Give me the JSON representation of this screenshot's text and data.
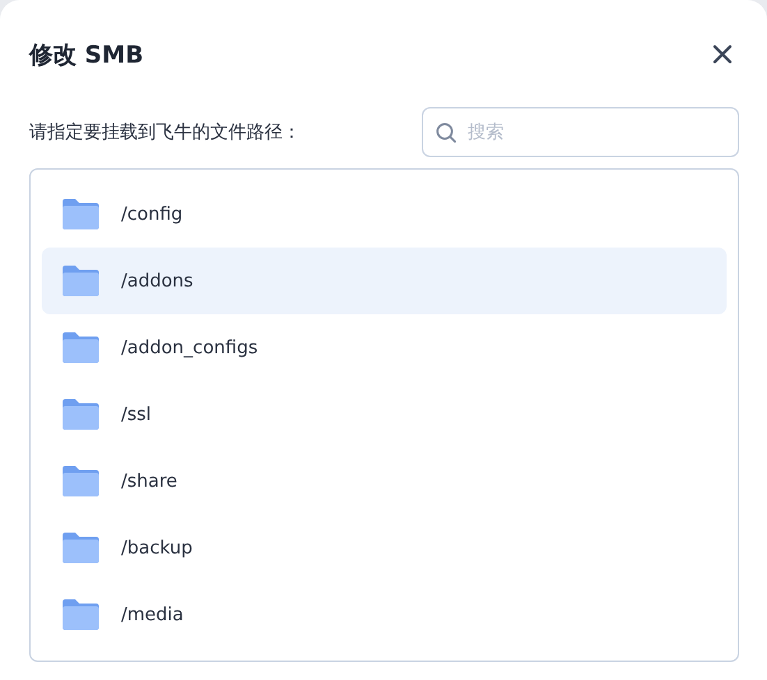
{
  "dialog": {
    "title": "修改 SMB"
  },
  "prompt": "请指定要挂载到飞牛的文件路径：",
  "search": {
    "placeholder": "搜索"
  },
  "folders": [
    {
      "name": "/config",
      "selected": false
    },
    {
      "name": "/addons",
      "selected": true
    },
    {
      "name": "/addon_configs",
      "selected": false
    },
    {
      "name": "/ssl",
      "selected": false
    },
    {
      "name": "/share",
      "selected": false
    },
    {
      "name": "/backup",
      "selected": false
    },
    {
      "name": "/media",
      "selected": false
    }
  ]
}
